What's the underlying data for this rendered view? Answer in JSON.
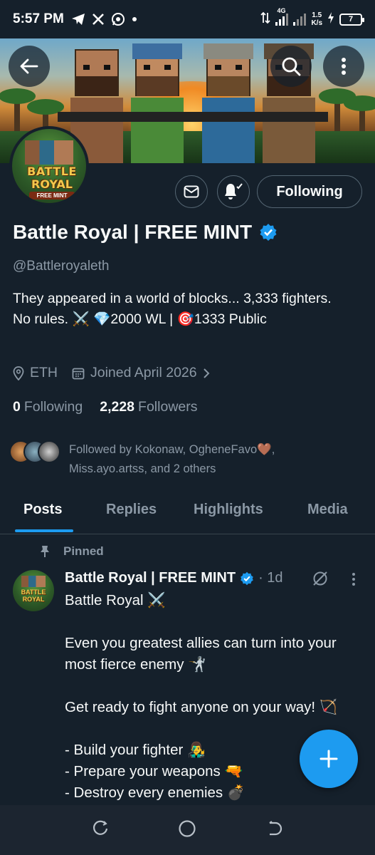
{
  "status_bar": {
    "time": "5:57 PM",
    "network_speed_top": "1.5",
    "network_speed_bottom": "K/s",
    "network_type": "4G",
    "battery": "7",
    "notification_icons": [
      "telegram-icon",
      "x-icon",
      "whatsapp-icon",
      "dot-icon"
    ]
  },
  "header": {
    "back_icon": "back-arrow-icon",
    "search_icon": "search-icon",
    "more_icon": "more-vertical-icon"
  },
  "profile": {
    "avatar_text": [
      "BATTLE",
      "ROYAL",
      "FREE MINT"
    ],
    "name": "Battle Royal | FREE MINT",
    "verified": true,
    "handle": "@Battleroyaleth",
    "bio": "They appeared in a world of blocks... 3,333 fighters. No rules. ⚔️ 💎2000 WL | 🎯1333 Public",
    "location": "ETH",
    "joined": "Joined April 2026",
    "following_count": "0",
    "following_label": "Following",
    "followers_count": "2,228",
    "followers_label": "Followers",
    "followed_by": "Followed by Kokonaw, OgheneFavo🤎, Miss.ayo.artss, and 2 others"
  },
  "actions": {
    "message_icon": "mail-icon",
    "notify_icon": "bell-check-icon",
    "follow_label": "Following"
  },
  "tabs": [
    {
      "label": "Posts",
      "active": true
    },
    {
      "label": "Replies",
      "active": false
    },
    {
      "label": "Highlights",
      "active": false
    },
    {
      "label": "Media",
      "active": false
    }
  ],
  "post": {
    "pinned_label": "Pinned",
    "author": "Battle Royal | FREE MINT",
    "time": "· 1d",
    "avatar_text": [
      "BATTLE",
      "ROYAL"
    ],
    "text": "Battle Royal ⚔️\n\nEven you greatest allies can turn into your most fierce enemy 🤺\n\nGet ready to fight anyone on your way! 🏹\n\n- Build your fighter 👨‍🎤\n- Prepare your weapons 🔫\n- Destroy every enemies 💣"
  },
  "fab": {
    "icon": "plus-icon"
  },
  "nav": {
    "icons": [
      "recent-apps-icon",
      "home-icon",
      "back-icon"
    ]
  },
  "colors": {
    "background": "#15202b",
    "accent": "#1d9bf0",
    "muted_text": "#8b98a5",
    "border": "#38444d",
    "verified": "#1d9bf0"
  }
}
